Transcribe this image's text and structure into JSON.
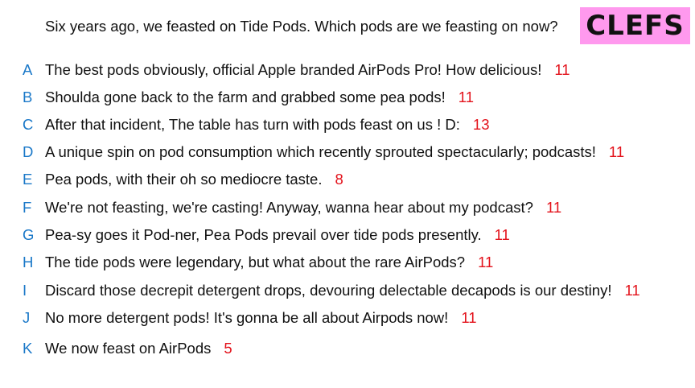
{
  "question": "Six years ago, we feasted on Tide Pods. Which pods are we feasting on now?",
  "badge": "CLEFS",
  "colors": {
    "letter": "#1a78c8",
    "score": "#e3121b",
    "badge_bg": "#ff99ee"
  },
  "answers": [
    {
      "letter": "A",
      "text": "The best pods obviously, official Apple branded AirPods Pro! How delicious!",
      "score": "11"
    },
    {
      "letter": "B",
      "text": "Shoulda gone back to the farm and grabbed some pea pods!",
      "score": "11"
    },
    {
      "letter": "C",
      "text": "After that incident, The table has turn with pods feast on us ! D:",
      "score": "13"
    },
    {
      "letter": "D",
      "text": "A unique spin on pod consumption which recently sprouted spectacularly; podcasts!",
      "score": "11"
    },
    {
      "letter": "E",
      "text": "Pea pods, with their oh so mediocre taste.",
      "score": "8"
    },
    {
      "letter": "F",
      "text": "We're not feasting, we're casting! Anyway, wanna hear about my podcast?",
      "score": "11"
    },
    {
      "letter": "G",
      "text": "Pea-sy goes it Pod-ner, Pea Pods prevail over tide pods presently.",
      "score": "11"
    },
    {
      "letter": "H",
      "text": "The tide pods were legendary, but what about the rare AirPods?",
      "score": "11"
    },
    {
      "letter": "I",
      "text": "Discard those decrepit detergent drops, devouring delectable decapods is our destiny!",
      "score": "11"
    },
    {
      "letter": "J",
      "text": "No more detergent pods! It's gonna be all about Airpods now!",
      "score": "11"
    },
    {
      "letter": "K",
      "text": "We now feast on AirPods",
      "score": "5"
    }
  ]
}
